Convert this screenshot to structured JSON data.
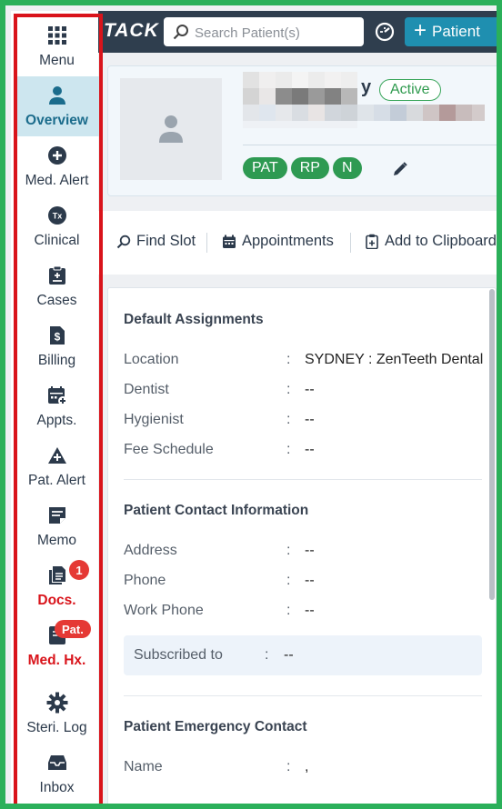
{
  "sidebar": {
    "items": [
      {
        "label": "Menu",
        "icon": "grid-icon"
      },
      {
        "label": "Overview",
        "icon": "person-icon"
      },
      {
        "label": "Med. Alert",
        "icon": "plus-circle-icon"
      },
      {
        "label": "Clinical",
        "icon": "rx-icon"
      },
      {
        "label": "Cases",
        "icon": "clipboard-icon"
      },
      {
        "label": "Billing",
        "icon": "dollar-file-icon"
      },
      {
        "label": "Appts.",
        "icon": "calendar-plus-icon"
      },
      {
        "label": "Pat. Alert",
        "icon": "warning-plus-icon"
      },
      {
        "label": "Memo",
        "icon": "memo-icon"
      },
      {
        "label": "Docs.",
        "icon": "documents-icon",
        "badge": "1"
      },
      {
        "label": "Med. Hx.",
        "icon": "history-icon",
        "badge": "Pat."
      },
      {
        "label": "Steri. Log",
        "icon": "gear-icon"
      },
      {
        "label": "Inbox",
        "icon": "inbox-icon"
      }
    ]
  },
  "header": {
    "logo_text": "TACK",
    "search_placeholder": "Search Patient(s)",
    "new_patient_label": "Patient"
  },
  "patient": {
    "name_suffix": "y",
    "status": "Active",
    "tags": [
      "PAT",
      "RP",
      "N"
    ]
  },
  "actions": {
    "find_slot": "Find Slot",
    "appointments": "Appointments",
    "add_to_clipboard": "Add to Clipboard"
  },
  "default_assignments": {
    "title": "Default Assignments",
    "rows": [
      {
        "label": "Location",
        "value": "SYDNEY : ZenTeeth Dental"
      },
      {
        "label": "Dentist",
        "value": "--"
      },
      {
        "label": "Hygienist",
        "value": "--"
      },
      {
        "label": "Fee Schedule",
        "value": "--"
      }
    ]
  },
  "contact_info": {
    "title": "Patient Contact Information",
    "rows": [
      {
        "label": "Address",
        "value": "--"
      },
      {
        "label": "Phone",
        "value": "--"
      },
      {
        "label": "Work Phone",
        "value": "--"
      }
    ],
    "subscribed": {
      "label": "Subscribed to",
      "value": "--"
    }
  },
  "emergency_contact": {
    "title": "Patient Emergency Contact",
    "rows": [
      {
        "label": "Name",
        "value": ","
      }
    ]
  },
  "colors": {
    "frame_green": "#2bb05a",
    "sidebar_outline_red": "#d9141b",
    "topbar": "#2f3e4e",
    "primary_button": "#1f8fb0",
    "tag_green": "#2e9a52",
    "badge_red": "#e53935"
  }
}
